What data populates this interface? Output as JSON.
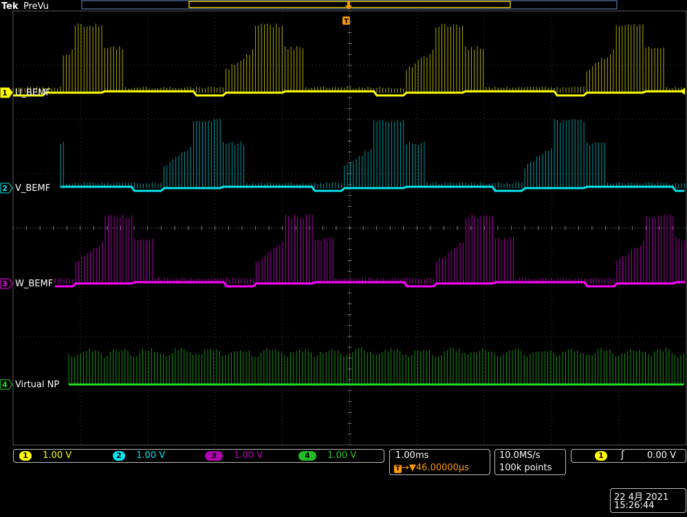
{
  "header": {
    "brand": "Tek",
    "mode": "PreVu",
    "trigger_marker": "T"
  },
  "channels": [
    {
      "num": "1",
      "label": "U_BEMF",
      "scale": "1.00 V",
      "color": "#ffff00"
    },
    {
      "num": "2",
      "label": "V_BEMF",
      "scale": "1.00 V",
      "color": "#00e5ee"
    },
    {
      "num": "3",
      "label": "W_BEMF",
      "scale": "1.00 V",
      "color": "#ff00ff"
    },
    {
      "num": "4",
      "label": "Virtual NP",
      "scale": "1.00 V",
      "color": "#22dd22"
    }
  ],
  "timebase": {
    "scale": "1.00ms",
    "trigger_position": "46.00000µs",
    "trigger_icon": "T"
  },
  "acquisition": {
    "rate": "10.0MS/s",
    "record": "100k points"
  },
  "trigger": {
    "source": "1",
    "slope_symbol": "ʃ",
    "level": "0.00 V"
  },
  "datetime": {
    "date": "22 4月  2021",
    "time": "15:26:44"
  },
  "chart_data": {
    "type": "line",
    "title": "",
    "xlabel": "",
    "ylabel": "",
    "x_divisions": 10,
    "y_divisions": 8,
    "grid": true,
    "series": [
      {
        "name": "U_BEMF",
        "period_ms": 2.68,
        "phase_ms": 0.0
      },
      {
        "name": "V_BEMF",
        "period_ms": 2.68,
        "phase_ms": -0.9
      },
      {
        "name": "W_BEMF",
        "period_ms": 2.68,
        "phase_ms": 0.45
      },
      {
        "name": "Virtual NP",
        "period_ms": 0.45,
        "phase_ms": 0.0
      }
    ]
  }
}
